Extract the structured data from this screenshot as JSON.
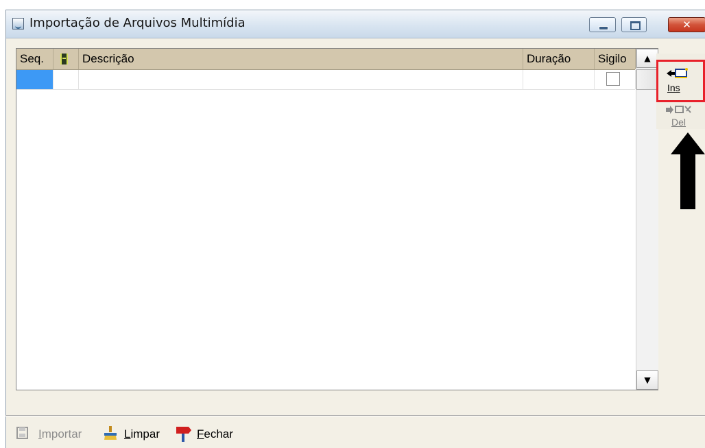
{
  "window": {
    "title": "Importação de Arquivos Multimídia"
  },
  "grid": {
    "columns": [
      "Seq.",
      "",
      "Descrição",
      "Duração",
      "Sigilo"
    ],
    "rows": [
      {
        "seq": "",
        "descricao": "",
        "duracao": "",
        "sigilo": false
      }
    ]
  },
  "side_buttons": {
    "ins": {
      "label": "Ins",
      "enabled": true
    },
    "del": {
      "label": "Del",
      "enabled": false
    }
  },
  "bottom_buttons": {
    "importar": {
      "first": "I",
      "rest": "mportar",
      "enabled": false
    },
    "limpar": {
      "first": "L",
      "rest": "impar",
      "enabled": true
    },
    "fechar": {
      "first": "F",
      "rest": "echar",
      "enabled": true
    }
  },
  "colors": {
    "selected_cell": "#3d99f5",
    "grid_header": "#d3c7ad",
    "highlight_box": "#e8202a",
    "annotation_arrow": "#000000"
  },
  "icons": {
    "app": "window-icon",
    "film_column": "film-icon",
    "ins": "insert-row-icon",
    "del": "delete-row-icon",
    "limpar": "broom-icon",
    "fechar": "sign-icon",
    "importar": "import-icon"
  }
}
